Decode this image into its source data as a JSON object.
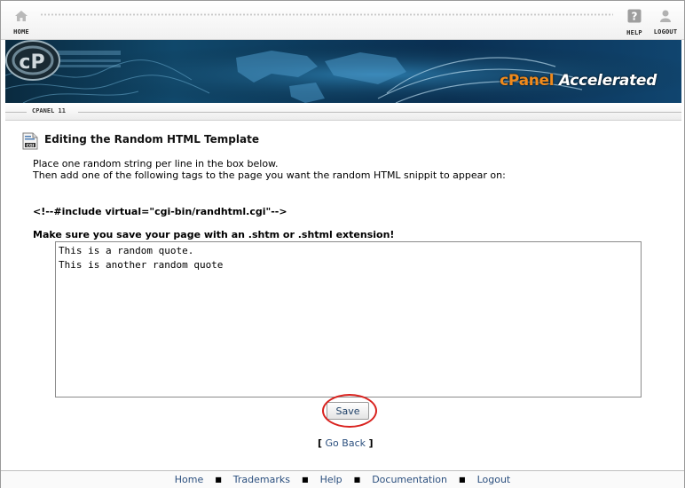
{
  "topnav": {
    "home_label": "HOME",
    "help_label": "HELP",
    "logout_label": "LOGOUT"
  },
  "banner": {
    "brand_prefix": "cPanel",
    "brand_suffix": "Accelerated",
    "logo_letters": "cP"
  },
  "version_label": "CPANEL 11",
  "page": {
    "title": "Editing the Random HTML Template",
    "instruction_line1": "Place one random string per line in the box below.",
    "instruction_line2": "Then add one of the following tags to the page you want the random HTML snippit to appear on:",
    "include_tag": "<!--#include virtual=\"cgi-bin/randhtml.cgi\"-->",
    "warning": "Make sure you save your page with an .shtm or .shtml extension!",
    "textarea_value": "This is a random quote.\nThis is another random quote",
    "save_label": "Save",
    "goback_open": "[",
    "goback_label": "Go Back",
    "goback_close": "]"
  },
  "footer": {
    "links": [
      "Home",
      "Trademarks",
      "Help",
      "Documentation",
      "Logout"
    ],
    "separator": "■"
  },
  "colors": {
    "link": "#2b4f7e",
    "highlight_circle": "#d9221e",
    "brand_orange": "#f08a1c"
  }
}
